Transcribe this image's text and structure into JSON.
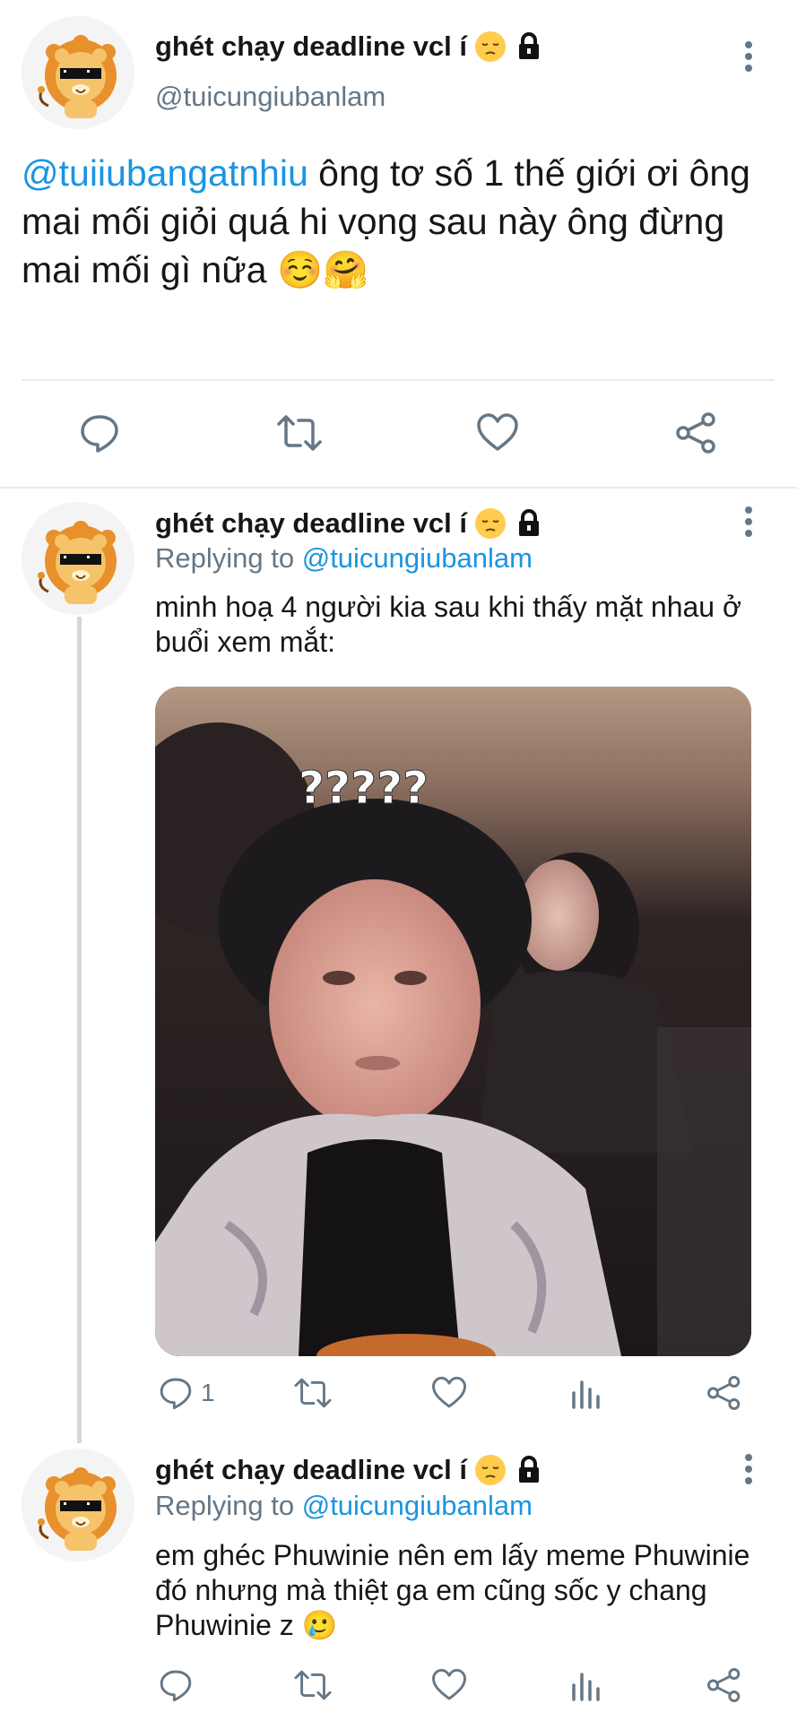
{
  "main_tweet": {
    "display_name": "ghét chạy deadline vcl í",
    "name_emoji": "pensive-face-icon",
    "lock": "lock-icon",
    "handle": "@tuicungiubanlam",
    "mention": "@tuiiubangatnhiu",
    "text": " ông tơ số 1 thế giới ơi ông mai mối giỏi quá hi vọng sau này ông đừng mai mối gì nữa ☺️🤗"
  },
  "reply1": {
    "display_name": "ghét chạy deadline vcl í",
    "replying_prefix": "Replying to ",
    "replying_to": "@tuicungiubanlam",
    "text": "minh hoạ 4 người kia sau khi thấy mặt nhau ở buổi xem mắt:",
    "image_overlay_text": "?????",
    "reply_count": "1"
  },
  "reply2": {
    "display_name": "ghét chạy deadline vcl í",
    "replying_prefix": "Replying to ",
    "replying_to": "@tuicungiubanlam",
    "text": "em ghéc Phuwinie nên em lấy meme Phuwinie đó nhưng mà thiệt ga em cũng sốc y chang Phuwinie z 🥲"
  },
  "colors": {
    "link": "#1b95e0",
    "secondary": "#657786",
    "divider": "#e6ecf0"
  }
}
